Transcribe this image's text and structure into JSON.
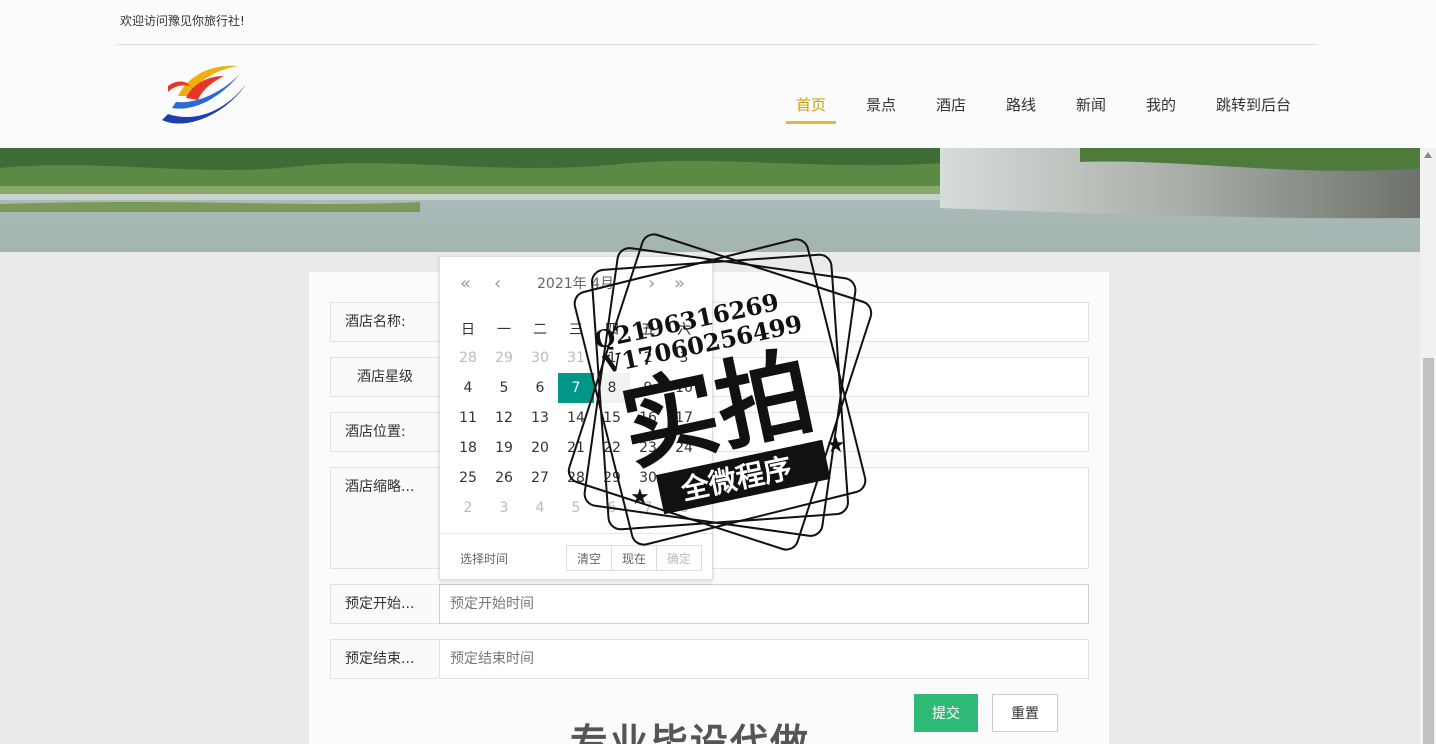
{
  "header": {
    "welcome": "欢迎访问豫见你旅行社!",
    "nav": [
      "首页",
      "景点",
      "酒店",
      "路线",
      "新闻",
      "我的",
      "跳转到后台"
    ],
    "active_index": 0
  },
  "colors": {
    "accent": "#e2b93b",
    "submit": "#2fbb77",
    "selected_day": "#009688"
  },
  "form": {
    "fields": [
      {
        "label": "酒店名称:",
        "value": "",
        "placeholder": ""
      },
      {
        "label": "酒店星级",
        "value": "",
        "placeholder": ""
      },
      {
        "label": "酒店位置:",
        "value": "",
        "placeholder": ""
      },
      {
        "label": "酒店缩略...",
        "value": "",
        "placeholder": ""
      },
      {
        "label": "预定开始...",
        "value": "",
        "placeholder": "预定开始时间"
      },
      {
        "label": "预定结束...",
        "value": "",
        "placeholder": "预定结束时间"
      }
    ],
    "submit": "提交",
    "reset": "重置"
  },
  "datepicker": {
    "title": "2021年 4月",
    "weekdays": [
      "日",
      "一",
      "二",
      "三",
      "四",
      "五",
      "六"
    ],
    "days": [
      [
        "28",
        "29",
        "30",
        "31",
        "1",
        "2",
        "3"
      ],
      [
        "4",
        "5",
        "6",
        "7",
        "8",
        "9",
        "10"
      ],
      [
        "11",
        "12",
        "13",
        "14",
        "15",
        "16",
        "17"
      ],
      [
        "18",
        "19",
        "20",
        "21",
        "22",
        "23",
        "24"
      ],
      [
        "25",
        "26",
        "27",
        "28",
        "29",
        "30",
        "1"
      ],
      [
        "2",
        "3",
        "4",
        "5",
        "6",
        "7",
        "8"
      ]
    ],
    "selected": "7",
    "select_time": "选择时间",
    "buttons": [
      "清空",
      "现在",
      "确定"
    ]
  },
  "watermark": {
    "qq": "Q2196316269",
    "wx": "V17060256499",
    "main": "实拍",
    "banner": "全微程序"
  },
  "bottom_text": "专业毕设代做"
}
